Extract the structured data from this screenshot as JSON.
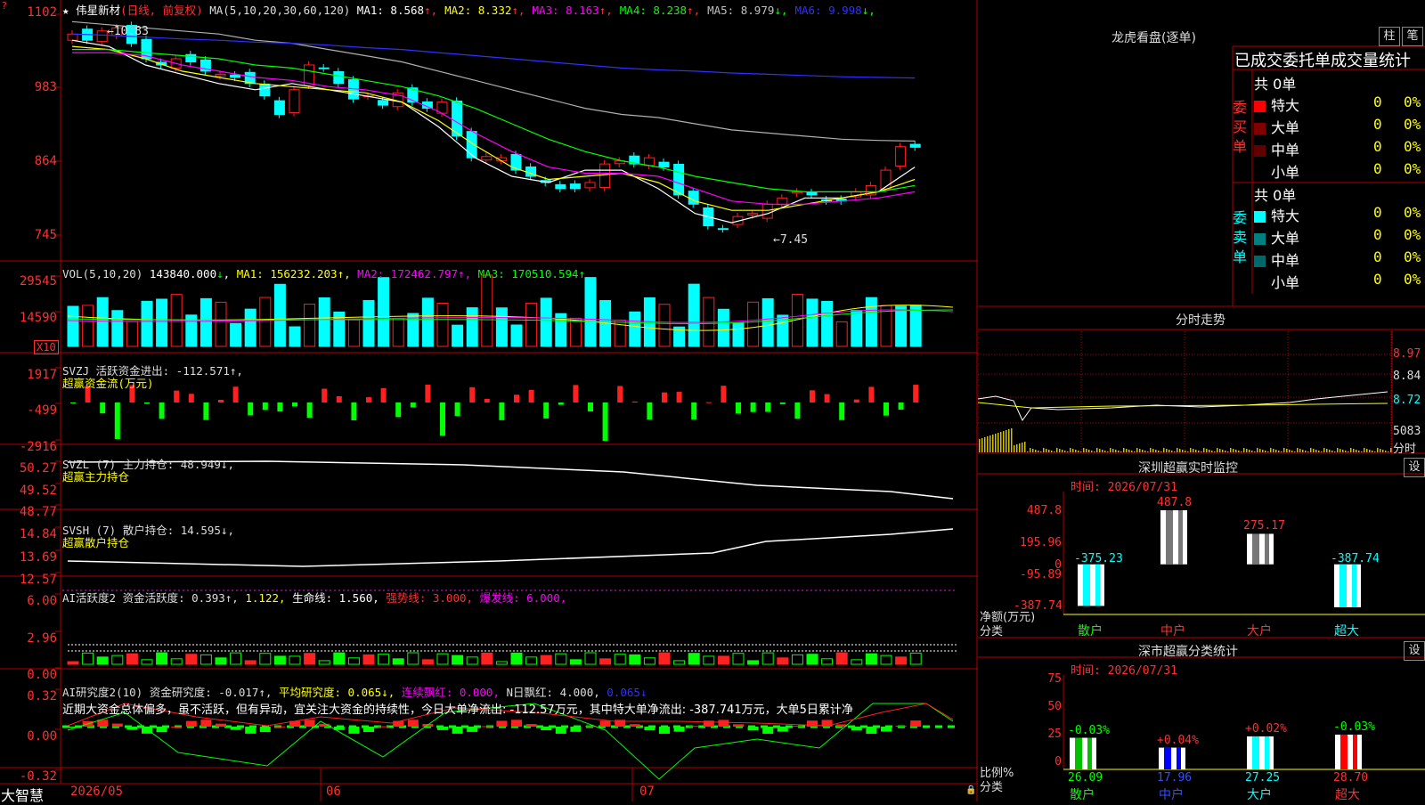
{
  "stock_header": {
    "star": "★",
    "name": "伟星新材",
    "mode": "(日线, 前复权)",
    "ma_label": "MA(5,10,20,30,60,120)",
    "ma": [
      {
        "label": "MA1:",
        "value": "8.568",
        "arrow": "↑",
        "color": "#ffffff"
      },
      {
        "label": "MA2:",
        "value": "8.332",
        "arrow": "↑",
        "color": "#ffff00"
      },
      {
        "label": "MA3:",
        "value": "8.163",
        "arrow": "↑",
        "color": "#ff00ff"
      },
      {
        "label": "MA4:",
        "value": "8.238",
        "arrow": "↑",
        "color": "#00ff00"
      },
      {
        "label": "MA5:",
        "value": "8.979",
        "arrow": "↓",
        "color": "#c0c0c0"
      },
      {
        "label": "MA6:",
        "value": "9.998",
        "arrow": "↓",
        "color": "#3030ff"
      }
    ]
  },
  "price_axis": [
    "1102",
    "983",
    "864",
    "745"
  ],
  "price_annotations": {
    "high": "←10.83",
    "low": "←7.45"
  },
  "vol_panel": {
    "title": "VOL(5,10,20)",
    "value": "143840.000",
    "value_arrow": "↓",
    "ma1": "MA1: 156232.203↑,",
    "ma2": "MA2: 172462.797↑,",
    "ma3": "MA3: 170510.594↑",
    "axis": [
      "29545",
      "14590"
    ],
    "unit": "X10"
  },
  "svzj_panel": {
    "title": "SVZJ  活跃资金进出: -112.571↑,",
    "subtitle": "超赢资金流(万元)",
    "axis": [
      "1917",
      "-499",
      "-2916"
    ]
  },
  "svzl_panel": {
    "title": "SVZL (7) 主力持仓: 48.949↓,",
    "subtitle": "超赢主力持仓",
    "axis": [
      "50.27",
      "49.52",
      "48.77"
    ]
  },
  "svsh_panel": {
    "title": "SVSH (7) 散户持仓: 14.595↓,",
    "subtitle": "超赢散户持仓",
    "axis": [
      "14.84",
      "13.69",
      "12.57"
    ]
  },
  "ai_active": {
    "title": "AI活跃度2 资金活跃度: 0.393↑,",
    "v2": "1.122,",
    "v3": "生命线: 1.560,",
    "v4": "强势线: 3.000,",
    "v5": "爆发线: 6.000,",
    "axis": [
      "6.00",
      "2.96",
      "0.00"
    ]
  },
  "ai_research": {
    "title": "AI研究度2(10) 资金研究度: -0.017↑,",
    "avg": "平均研究度: 0.065↓,",
    "cont": "连续飘红: 0.000,",
    "n": "N日飘红: 4.000,",
    "last": "0.065↓",
    "comment": "近期大资金总体偏多，虽不活跃，但有异动，宜关注大资金的持续性，今日大单净流出: -112.57万元，其中特大单净流出: -387.741万元，大单5日累计净",
    "axis": [
      "0.32",
      "0.00",
      "-0.32"
    ]
  },
  "date_axis": {
    "logo": "大智慧",
    "labels": [
      "2026/05",
      "06",
      "07"
    ]
  },
  "dragon": {
    "title": "龙虎看盘(逐单)",
    "btn1": "柱",
    "btn2": "笔",
    "banner": "已成交委托单成交量统计",
    "buy_label": "委买单",
    "sell_label": "委卖单",
    "buy_total": "共 0单",
    "sell_total": "共 0单",
    "buy_rows": [
      {
        "name": "特大",
        "count": "0",
        "pct": "0%",
        "color": "#ff0000"
      },
      {
        "name": "大单",
        "count": "0",
        "pct": "0%",
        "color": "#800000"
      },
      {
        "name": "中单",
        "count": "0",
        "pct": "0%",
        "color": "#600000"
      },
      {
        "name": "小单",
        "count": "0",
        "pct": "0%",
        "color": "#000000"
      }
    ],
    "sell_rows": [
      {
        "name": "特大",
        "count": "0",
        "pct": "0%",
        "color": "#00ffff"
      },
      {
        "name": "大单",
        "count": "0",
        "pct": "0%",
        "color": "#008080"
      },
      {
        "name": "中单",
        "count": "0",
        "pct": "0%",
        "color": "#006868"
      },
      {
        "name": "小单",
        "count": "0",
        "pct": "0%",
        "color": "#000000"
      }
    ]
  },
  "intraday": {
    "title": "分时走势",
    "axis": [
      "8.97",
      "8.84",
      "8.72"
    ],
    "vol_label": "5083",
    "vol_unit": "分时"
  },
  "sz_monitor": {
    "title": "深圳超赢实时监控",
    "setting": "设",
    "time": "时间: 2026/07/31",
    "axis": [
      "487.8",
      "195.96",
      "0",
      "-95.89",
      "-387.74"
    ],
    "axis_caption": "净额(万元)",
    "cat_caption": "分类",
    "categories": [
      "散户",
      "中户",
      "大户",
      "超大"
    ]
  },
  "sz_stats": {
    "title": "深市超赢分类统计",
    "setting": "设",
    "time": "时间: 2026/07/31",
    "axis": [
      "75",
      "50",
      "25",
      "0"
    ],
    "axis_caption": "比例%",
    "cat_caption": "分类",
    "categories": [
      "散户",
      "中户",
      "大户",
      "超大"
    ]
  },
  "chart_data": [
    {
      "type": "bar",
      "title": "深圳超赢实时监控",
      "ylabel": "净额(万元)",
      "categories": [
        "散户",
        "中户",
        "大户",
        "超大"
      ],
      "values": [
        -375.23,
        487.8,
        275.17,
        -387.74
      ],
      "value_labels": [
        "-375.23",
        "487.8",
        "275.17",
        "-387.74"
      ],
      "ylim": [
        -387.74,
        487.8
      ]
    },
    {
      "type": "bar",
      "title": "深市超赢分类统计",
      "ylabel": "比例%",
      "categories": [
        "散户",
        "中户",
        "大户",
        "超大"
      ],
      "values": [
        26.09,
        17.96,
        27.25,
        28.7
      ],
      "value_labels": [
        "26.09",
        "17.96",
        "27.25",
        "28.70"
      ],
      "change_labels": [
        "-0.03%",
        "+0.04%",
        "+0.02%",
        "-0.03%"
      ],
      "bar_colors": [
        "#00c000",
        "#0000ff",
        "#00ffff",
        "#ff0000"
      ],
      "ylim": [
        0,
        75
      ]
    }
  ]
}
